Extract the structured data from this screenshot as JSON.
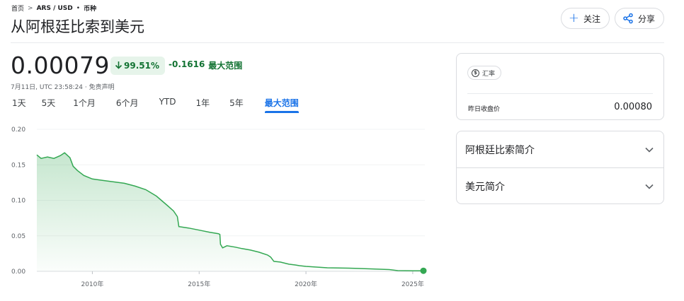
{
  "breadcrumb": {
    "home": "首页",
    "sep": ">",
    "pair": "ARS / USD",
    "dot": "•",
    "category": "币种"
  },
  "title": "从阿根廷比索到美元",
  "actions": {
    "follow": "关注",
    "share": "分享"
  },
  "quote": {
    "price": "0.00079",
    "change_pct": "99.51%",
    "change_abs": "-0.1616",
    "change_period": "最大范围",
    "timestamp": "7月11日, UTC 23:58:24 ·",
    "disclaimer": "免责声明"
  },
  "range_tabs": [
    "1天",
    "5天",
    "1个月",
    "6个月",
    "YTD",
    "1年",
    "5年",
    "最大范围"
  ],
  "active_range": "最大范围",
  "colors": {
    "accent": "#1a73e8",
    "positive": "#137333",
    "line": "#34a853"
  },
  "rate_card": {
    "chip_label": "汇率",
    "chip_icon": "dollar-icon",
    "prev_close_label": "昨日收盘价",
    "prev_close_value": "0.00080"
  },
  "about": {
    "ars": "阿根廷比索简介",
    "usd": "美元简介"
  },
  "chart_data": {
    "type": "area",
    "title": "",
    "xlabel": "",
    "ylabel": "",
    "ylim": [
      0,
      0.2
    ],
    "xlim": [
      2007.4,
      2025.5
    ],
    "yticks": [
      "0.20",
      "0.15",
      "0.10",
      "0.05",
      "0.00"
    ],
    "xticks": [
      "2010年",
      "2015年",
      "2020年",
      "2025年"
    ],
    "grid": true,
    "series": [
      {
        "x": [
          2007.4,
          2007.6,
          2007.9,
          2008.2,
          2008.5,
          2008.7,
          2008.95,
          2009.1,
          2009.3,
          2009.6,
          2010.0,
          2010.5,
          2011.0,
          2011.5,
          2012.0,
          2012.5,
          2013.0,
          2013.5,
          2013.8,
          2013.98,
          2014.05,
          2014.5,
          2015.0,
          2015.5,
          2015.9,
          2015.97,
          2016.0,
          2016.1,
          2016.3,
          2016.7,
          2017.0,
          2017.4,
          2017.8,
          2018.2,
          2018.35,
          2018.5,
          2018.8,
          2019.2,
          2019.5,
          2019.7,
          2020.0,
          2020.5,
          2021.0,
          2022.0,
          2023.0,
          2023.9,
          2024.3,
          2025.0,
          2025.5
        ],
        "y": [
          0.164,
          0.159,
          0.161,
          0.159,
          0.163,
          0.167,
          0.16,
          0.148,
          0.142,
          0.135,
          0.13,
          0.128,
          0.126,
          0.124,
          0.12,
          0.115,
          0.106,
          0.093,
          0.085,
          0.077,
          0.063,
          0.061,
          0.058,
          0.055,
          0.053,
          0.052,
          0.038,
          0.033,
          0.036,
          0.034,
          0.032,
          0.03,
          0.027,
          0.023,
          0.02,
          0.014,
          0.013,
          0.01,
          0.009,
          0.008,
          0.007,
          0.006,
          0.005,
          0.0045,
          0.0035,
          0.0025,
          0.00095,
          0.0008,
          0.00079
        ]
      }
    ]
  }
}
